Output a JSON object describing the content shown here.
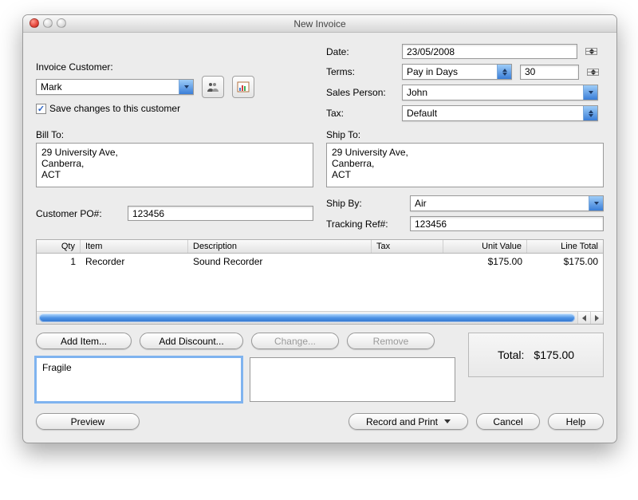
{
  "window_title": "New Invoice",
  "left": {
    "invoice_customer_label": "Invoice Customer:",
    "customer_value": "Mark",
    "save_changes_label": "Save changes to this customer",
    "save_changes_checked": "✓",
    "bill_to_label": "Bill To:",
    "bill_to_text": "29 University Ave,\nCanberra,\nACT",
    "customer_po_label": "Customer PO#:",
    "customer_po_value": "123456"
  },
  "right": {
    "date_label": "Date:",
    "date_value": "23/05/2008",
    "terms_label": "Terms:",
    "terms_value": "Pay in Days",
    "terms_days": "30",
    "sales_person_label": "Sales Person:",
    "sales_person_value": "John",
    "tax_label": "Tax:",
    "tax_value": "Default",
    "ship_to_label": "Ship To:",
    "ship_to_text": "29 University Ave,\nCanberra,\nACT",
    "ship_by_label": "Ship By:",
    "ship_by_value": "Air",
    "tracking_label": "Tracking Ref#:",
    "tracking_value": "123456"
  },
  "table": {
    "headers": {
      "qty": "Qty",
      "item": "Item",
      "desc": "Description",
      "tax": "Tax",
      "uv": "Unit Value",
      "lt": "Line Total"
    },
    "row0": {
      "qty": "1",
      "item": "Recorder",
      "desc": "Sound Recorder",
      "tax": "",
      "uv": "$175.00",
      "lt": "$175.00"
    }
  },
  "buttons": {
    "add_item": "Add Item...",
    "add_discount": "Add Discount...",
    "change": "Change...",
    "remove": "Remove",
    "preview": "Preview",
    "record_print": "Record and Print",
    "cancel": "Cancel",
    "help": "Help"
  },
  "notes": {
    "comment": "Fragile"
  },
  "total": {
    "label": "Total:",
    "value": "$175.00"
  }
}
